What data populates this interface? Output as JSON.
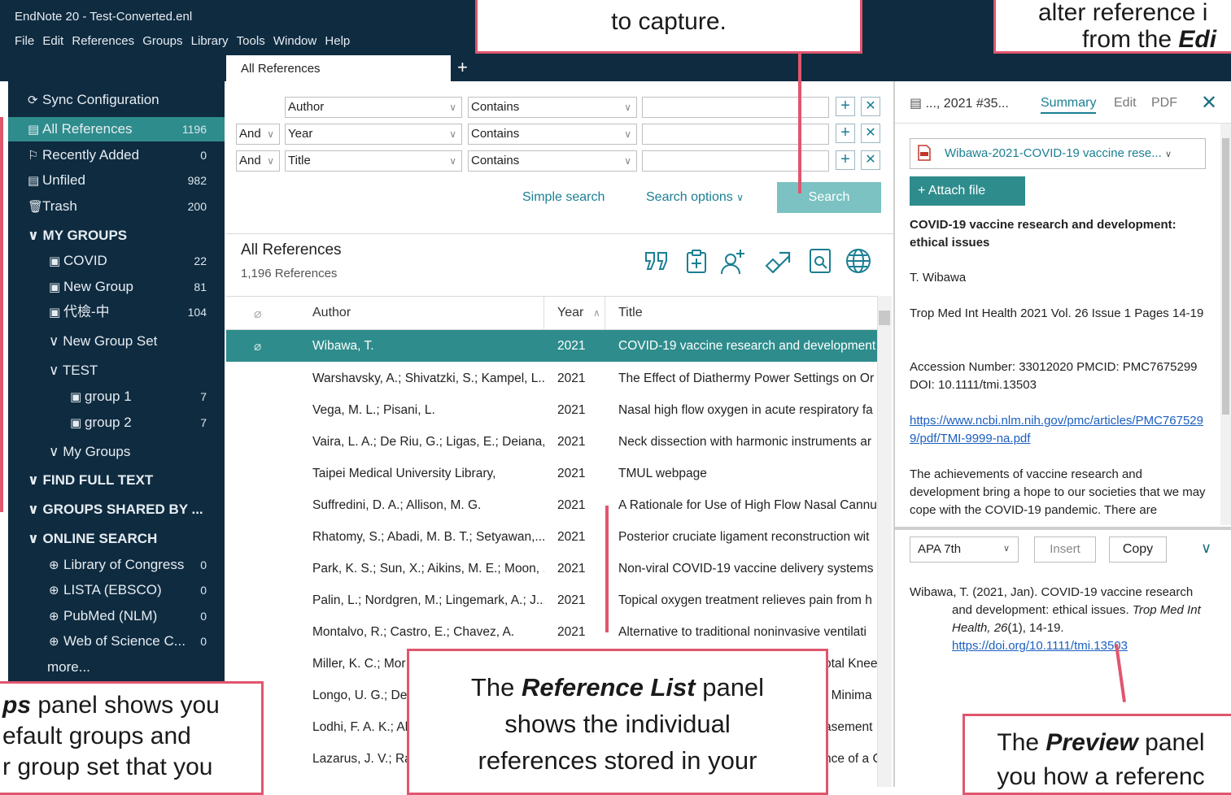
{
  "window": {
    "title": "EndNote 20 - Test-Converted.enl"
  },
  "menu": [
    "File",
    "Edit",
    "References",
    "Groups",
    "Library",
    "Tools",
    "Window",
    "Help"
  ],
  "tab": {
    "label": "All References",
    "add_glyph": "+"
  },
  "sidebar": {
    "items": [
      {
        "glyph": "⟳",
        "label": "Sync Configuration",
        "count": ""
      },
      {
        "glyph": "▤",
        "label": "All References",
        "count": "1196"
      },
      {
        "glyph": "⚐",
        "label": "Recently Added",
        "count": "0"
      },
      {
        "glyph": "▤",
        "label": "Unfiled",
        "count": "982"
      },
      {
        "glyph": "🗑",
        "label": "Trash",
        "count": "200"
      }
    ],
    "my_groups_header": "MY GROUPS",
    "groups": [
      {
        "label": "COVID",
        "count": "22"
      },
      {
        "label": "New Group",
        "count": "81"
      },
      {
        "label": "代檢-中",
        "count": "104"
      }
    ],
    "group_set": "New Group Set",
    "test_set": "TEST",
    "test_groups": [
      {
        "label": "group 1",
        "count": "7"
      },
      {
        "label": "group 2",
        "count": "7"
      }
    ],
    "my_groups_set": "My Groups",
    "find_full_text": "FIND FULL TEXT",
    "groups_shared": "GROUPS SHARED BY ...",
    "online_search": "ONLINE SEARCH",
    "online": [
      {
        "label": "Library of Congress",
        "count": "0"
      },
      {
        "label": "LISTA (EBSCO)",
        "count": "0"
      },
      {
        "label": "PubMed (NLM)",
        "count": "0"
      },
      {
        "label": "Web of Science C...",
        "count": "0"
      }
    ],
    "more": "more..."
  },
  "search": {
    "rows": [
      {
        "bool": "",
        "field": "Author",
        "op": "Contains"
      },
      {
        "bool": "And",
        "field": "Year",
        "op": "Contains"
      },
      {
        "bool": "And",
        "field": "Title",
        "op": "Contains"
      }
    ],
    "simple_search": "Simple search",
    "search_options": "Search options",
    "search_button": "Search"
  },
  "list": {
    "title": "All References",
    "count": "1,196 References",
    "columns": {
      "author": "Author",
      "year": "Year",
      "title": "Title"
    },
    "rows": [
      {
        "author": "Wibawa, T.",
        "year": "2021",
        "title": "COVID-19 vaccine research and development",
        "selected": true
      },
      {
        "author": "Warshavsky, A.; Shivatzki, S.; Kampel, L....",
        "year": "2021",
        "title": "The Effect of Diathermy Power Settings on Or"
      },
      {
        "author": "Vega, M. L.; Pisani, L.",
        "year": "2021",
        "title": "Nasal high flow oxygen in acute respiratory fa"
      },
      {
        "author": "Vaira, L. A.; De Riu, G.; Ligas, E.; Deiana,...",
        "year": "2021",
        "title": "Neck dissection with harmonic instruments ar"
      },
      {
        "author": "Taipei Medical University Library,",
        "year": "2021",
        "title": "TMUL webpage"
      },
      {
        "author": "Suffredini, D. A.; Allison, M. G.",
        "year": "2021",
        "title": "A Rationale for Use of High Flow Nasal Cannu"
      },
      {
        "author": "Rhatomy, S.; Abadi, M. B. T.; Setyawan,...",
        "year": "2021",
        "title": "Posterior cruciate ligament reconstruction wit"
      },
      {
        "author": "Park, K. S.; Sun, X.; Aikins, M. E.; Moon, ...",
        "year": "2021",
        "title": "Non-viral COVID-19 vaccine delivery systems"
      },
      {
        "author": "Palin, L.; Nordgren, M.; Lingemark, A.; J...",
        "year": "2021",
        "title": "Topical oxygen treatment relieves pain from h"
      },
      {
        "author": "Montalvo, R.; Castro, E.; Chavez, A.",
        "year": "2021",
        "title": "Alternative to traditional noninvasive ventilati"
      },
      {
        "author": "Miller, K. C.; Mor",
        "year": "",
        "title": "otal Knee"
      },
      {
        "author": "Longo, U. G.; De",
        "year": "",
        "title": ": Minima"
      },
      {
        "author": "Lodhi, F. A. K.; Ak",
        "year": "",
        "title": "asement"
      },
      {
        "author": "Lazarus, J. V.; Rat",
        "year": "",
        "title": "nce of a C"
      }
    ]
  },
  "reference_panel": {
    "ref_label": "..., 2021 #35...",
    "tabs": {
      "summary": "Summary",
      "edit": "Edit",
      "pdf": "PDF"
    },
    "close_glyph": "✕",
    "attachment": "Wibawa-2021-COVID-19 vaccine rese...",
    "attach_button": "+ Attach file",
    "title": "COVID-19 vaccine research and development: ethical issues",
    "author": "T. Wibawa",
    "journal": "Trop Med Int Health 2021 Vol. 26 Issue 1 Pages 14-19",
    "accession": "Accession Number: 33012020 PMCID: PMC7675299 DOI: 10.1111/tmi.13503",
    "url": "https://www.ncbi.nlm.nih.gov/pmc/articles/PMC7675299/pdf/TMI-9999-na.pdf",
    "abstract": "The achievements of vaccine research and development bring a hope to our societies that we may cope with the COVID-19 pandemic. There are"
  },
  "preview": {
    "style": "APA 7th",
    "insert": "Insert",
    "copy": "Copy",
    "citation_line1": "Wibawa, T. (2021, Jan). COVID-19 vaccine research",
    "citation_line2": "and development: ethical issues. ",
    "citation_journal": "Trop Med Int Health, 26",
    "citation_rest": "(1), 14-19.",
    "citation_doi": "https://doi.org/10.1111/tmi.13503"
  },
  "callouts": {
    "top_center": "to capture.",
    "top_right_l1": "alter reference i",
    "top_right_l2a": "from the ",
    "top_right_l2b": "Edi",
    "groups_l1a": "ps",
    "groups_l1b": " panel shows you",
    "groups_l2": "efault groups and",
    "groups_l3": "r group set that you",
    "reflist_l1a": "The ",
    "reflist_l1b": "Reference List",
    "reflist_l1c": " panel",
    "reflist_l2": "shows the individual",
    "reflist_l3": "references stored in your",
    "preview_l1a": "The ",
    "preview_l1b": "Preview",
    "preview_l1c": " panel",
    "preview_l2": "you how a referenc"
  },
  "colors": {
    "sidebar": "#0f2b40",
    "accent": "#2e8c8c",
    "callout_border": "#e0566e"
  }
}
